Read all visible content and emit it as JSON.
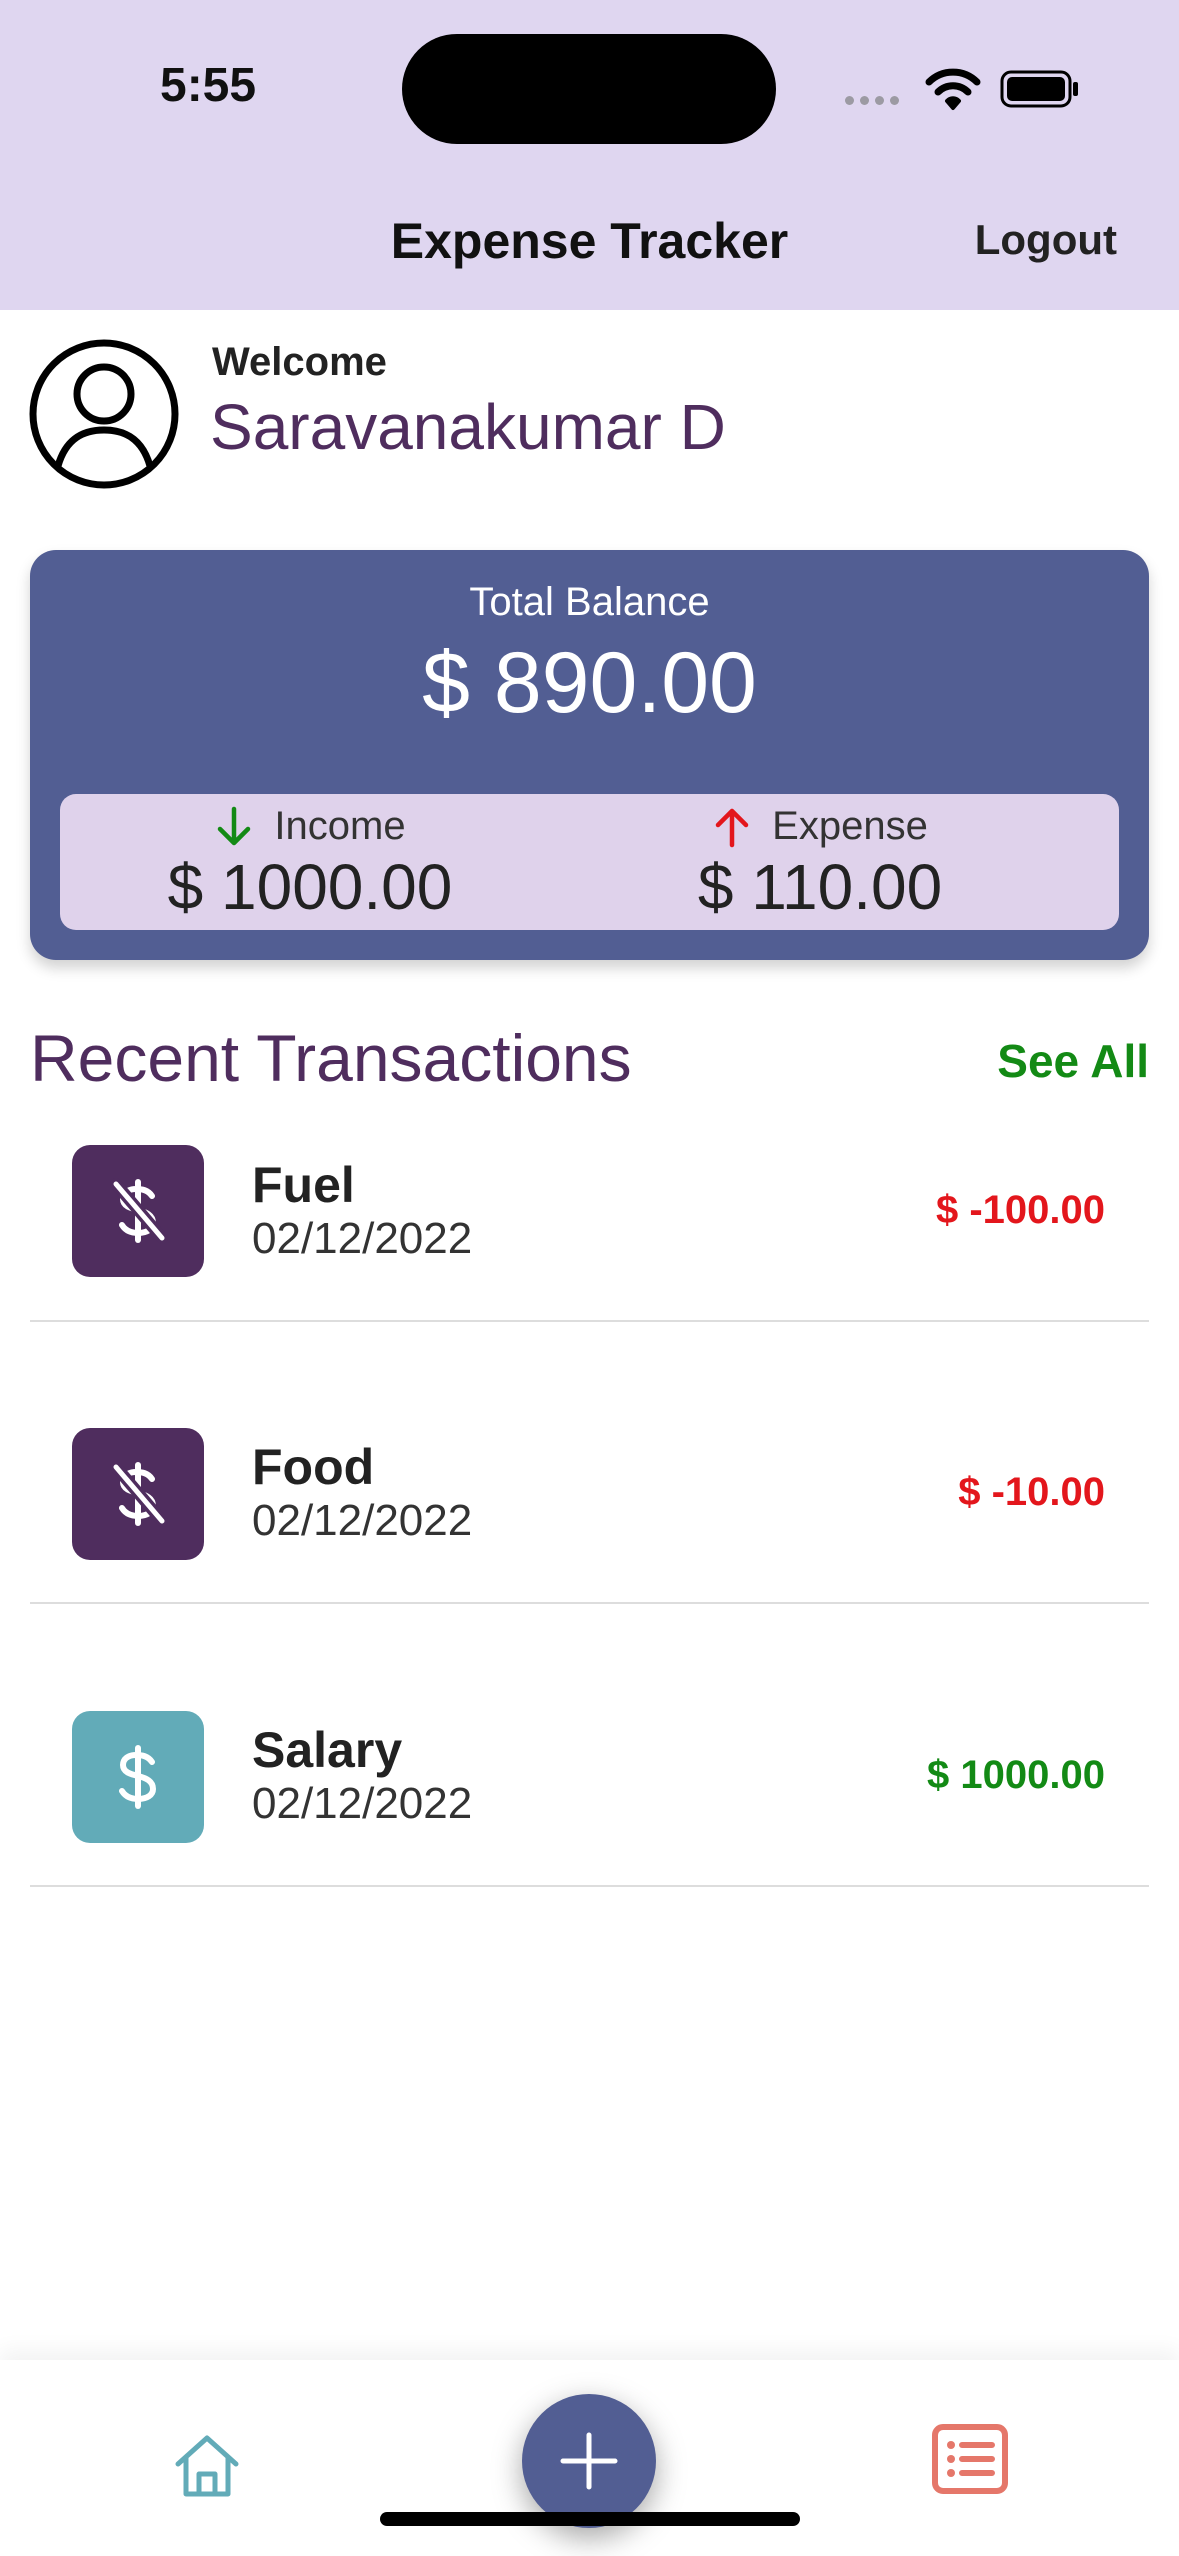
{
  "status_bar": {
    "time": "5:55"
  },
  "header": {
    "title": "Expense Tracker",
    "logout_label": "Logout"
  },
  "profile": {
    "welcome_label": "Welcome",
    "user_name": "Saravanakumar D",
    "avatar_icon": "user-circle-icon"
  },
  "balance": {
    "label": "Total Balance",
    "value": "$ 890.00",
    "income": {
      "label": "Income",
      "value": "$ 1000.00",
      "icon": "arrow-down-icon",
      "color": "#138A15"
    },
    "expense": {
      "label": "Expense",
      "value": "$ 110.00",
      "icon": "arrow-up-icon",
      "color": "#E3161C"
    }
  },
  "recent": {
    "title": "Recent Transactions",
    "see_all_label": "See All",
    "items": [
      {
        "name": "Fuel",
        "date": "02/12/2022",
        "amount": "$ -100.00",
        "type": "expense",
        "icon": "dollar-off-icon",
        "icon_bg": "#4F2D5E",
        "amount_color": "#E3161C"
      },
      {
        "name": "Food",
        "date": "02/12/2022",
        "amount": "$ -10.00",
        "type": "expense",
        "icon": "dollar-off-icon",
        "icon_bg": "#4F2D5E",
        "amount_color": "#E3161C"
      },
      {
        "name": "Salary",
        "date": "02/12/2022",
        "amount": "$ 1000.00",
        "type": "income",
        "icon": "dollar-icon",
        "icon_bg": "#62ABB8",
        "amount_color": "#138A15"
      }
    ]
  },
  "tabbar": {
    "home_icon": "home-icon",
    "add_icon": "plus-icon",
    "list_icon": "list-icon"
  },
  "colors": {
    "header_bg": "#DFD6F0",
    "card_bg": "#525E93",
    "accent_purple": "#4F2D5E",
    "see_all": "#138A15"
  }
}
